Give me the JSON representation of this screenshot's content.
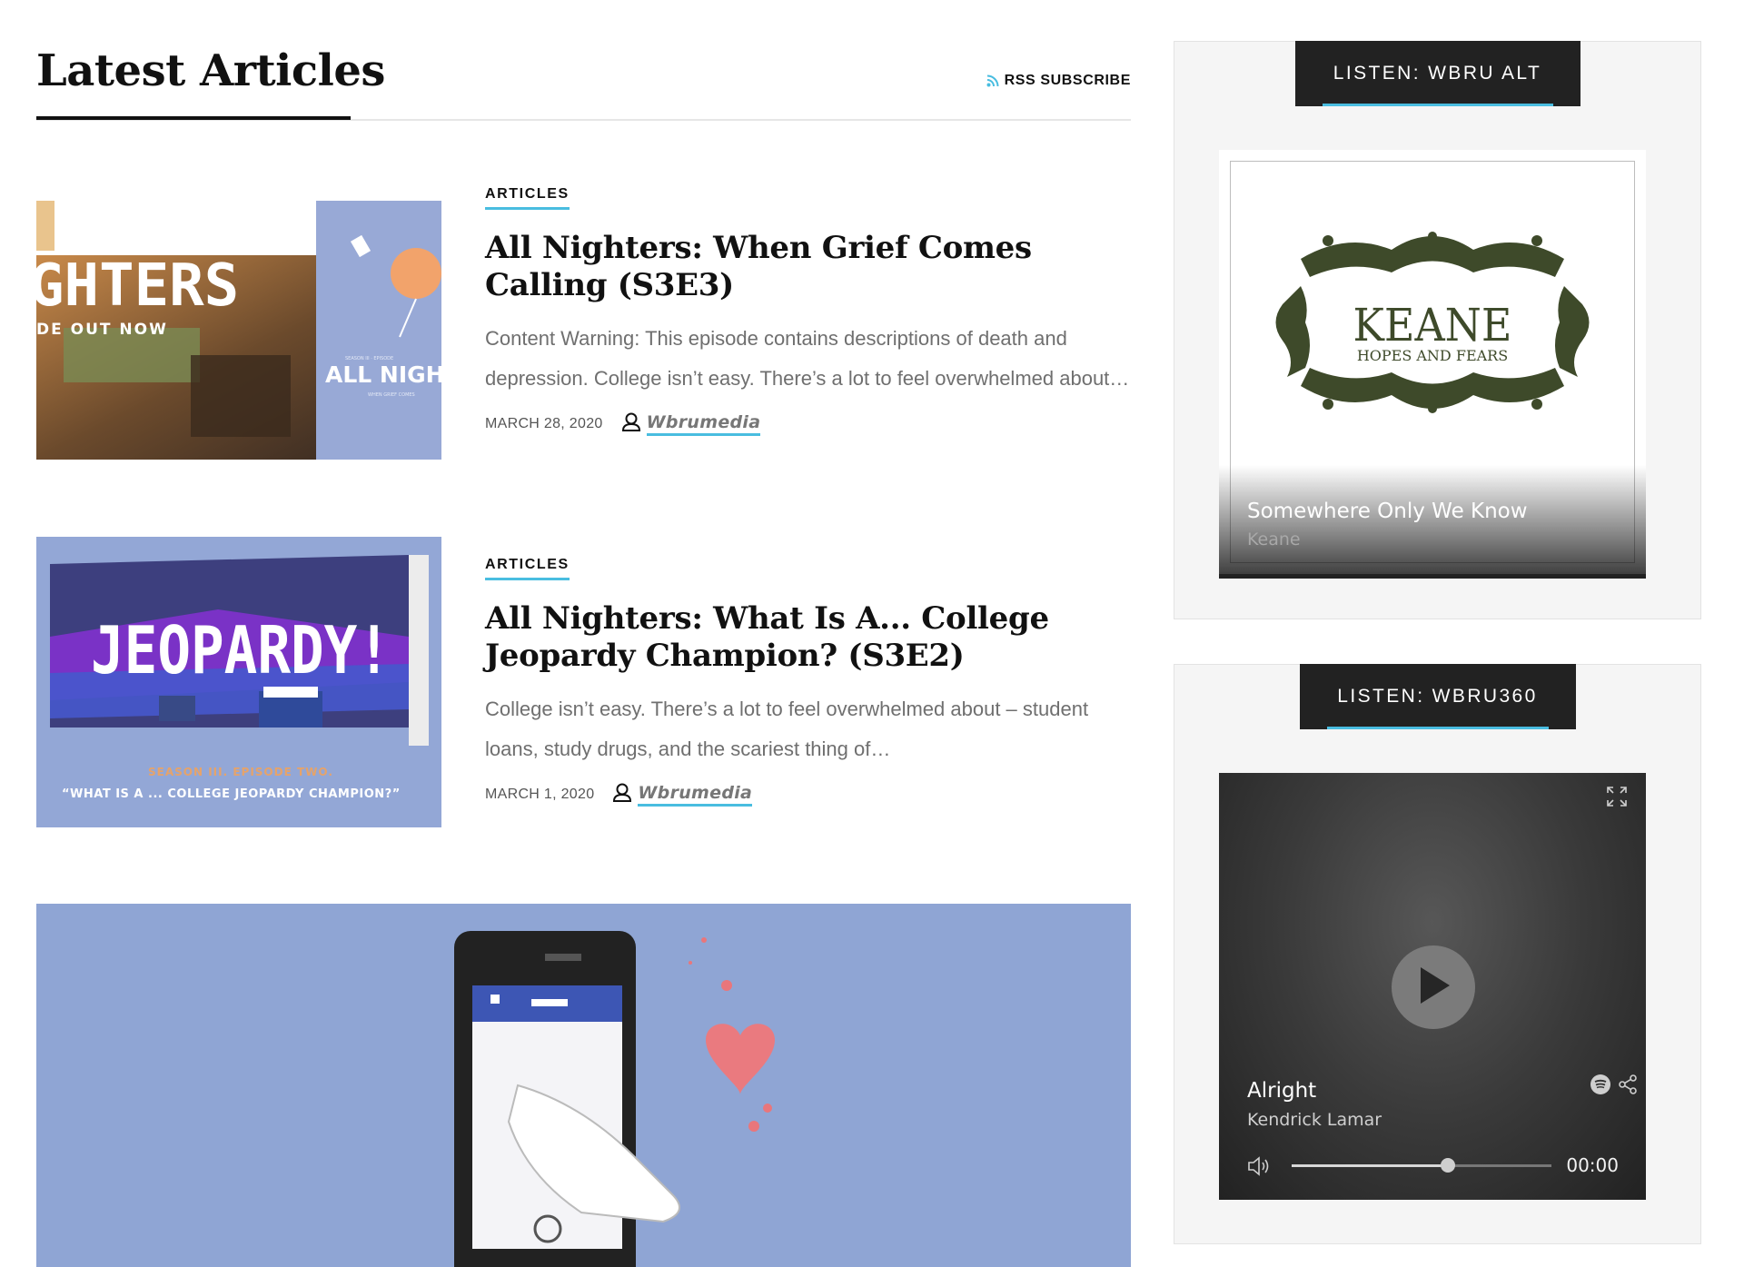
{
  "section": {
    "title": "Latest Articles",
    "rss_label": "RSS SUBSCRIBE"
  },
  "articles": [
    {
      "category": "ARTICLES",
      "title": "All Nighters: When Grief Comes Calling (S3E3)",
      "excerpt": "Content Warning: This episode contains descriptions of death and depression. College isn’t easy. There’s a lot to feel overwhelmed about…",
      "date": "MARCH 28, 2020",
      "author": "Wbrumedia",
      "thumb_text": {
        "top": "GHTERS",
        "sub": "DE OUT NOW",
        "card": "ALL NIGH",
        "card_small": "SEASON III · EPISODE",
        "card_tiny": "WHEN GRIEF COMES"
      }
    },
    {
      "category": "ARTICLES",
      "title": "All Nighters: What Is A... College Jeopardy Champion? (S3E2)",
      "excerpt": "College isn’t easy. There’s a lot to feel overwhelmed about – student loans, study drugs, and the scariest thing of…",
      "date": "MARCH 1, 2020",
      "author": "Wbrumedia",
      "thumb_text": {
        "logo": "JEOPARDY!",
        "season": "SEASON III.  EPISODE TWO.",
        "caption": "“WHAT IS A ... COLLEGE JEOPARDY CHAMPION?”"
      }
    }
  ],
  "sidebar": {
    "widgets": [
      {
        "tab": "LISTEN: WBRU ALT",
        "album_band": "KEANE",
        "album_title": "HOPES AND FEARS",
        "track": "Somewhere Only We Know",
        "artist": "Keane"
      },
      {
        "tab": "LISTEN: WBRU360",
        "track": "Alright",
        "artist": "Kendrick Lamar",
        "time": "00:00",
        "progress": 0.6
      }
    ]
  },
  "colors": {
    "accent": "#49bde0",
    "featured_bg": "#8fa5d4",
    "tab_bg": "#222222"
  },
  "icons": [
    "rss-icon",
    "user-icon",
    "play-icon",
    "volume-icon",
    "expand-icon",
    "spotify-icon",
    "share-icon",
    "heart-icon"
  ]
}
